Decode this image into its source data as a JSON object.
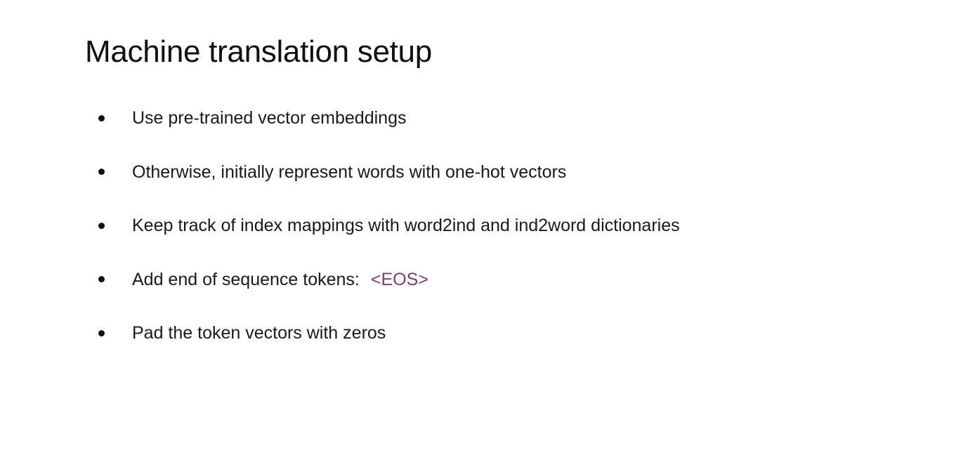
{
  "slide": {
    "title": "Machine translation setup",
    "bullets": [
      {
        "text": "Use pre-trained vector embeddings"
      },
      {
        "text": "Otherwise, initially represent words with one-hot vectors"
      },
      {
        "text": "Keep track of index mappings with word2ind and ind2word dictionaries"
      },
      {
        "text": "Add end of sequence tokens:",
        "token": "<EOS>"
      },
      {
        "text": "Pad the token vectors with zeros"
      }
    ]
  },
  "colors": {
    "background": "#ffffff",
    "text": "#1a1a1a",
    "token_accent": "#7a3f72"
  },
  "icons": {
    "bullet": "bullet-dot-icon"
  }
}
